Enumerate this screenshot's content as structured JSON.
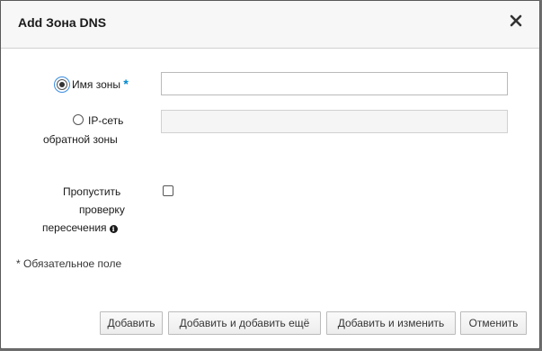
{
  "dialog": {
    "title": "Add Зона DNS",
    "close_icon": "close-icon"
  },
  "form": {
    "zone_name": {
      "label": "Имя зоны",
      "required_mark": "*",
      "value": "",
      "selected": true
    },
    "reverse_zone": {
      "label_line1": "IP-сеть",
      "label_line2": "обратной зоны",
      "value": "",
      "disabled": true,
      "selected": false
    },
    "skip_overlap_check": {
      "label_line1": "Пропустить",
      "label_line2": "проверку",
      "label_line3": "пересечения",
      "info_icon": "info-icon",
      "checked": false
    }
  },
  "note": "* Обязательное поле",
  "buttons": {
    "add": "Добавить",
    "add_and_add_another": "Добавить и добавить ещё",
    "add_and_edit": "Добавить и изменить",
    "cancel": "Отменить"
  },
  "colors": {
    "required_accent": "#0088ce",
    "header_bg": "#f7f7f7"
  }
}
